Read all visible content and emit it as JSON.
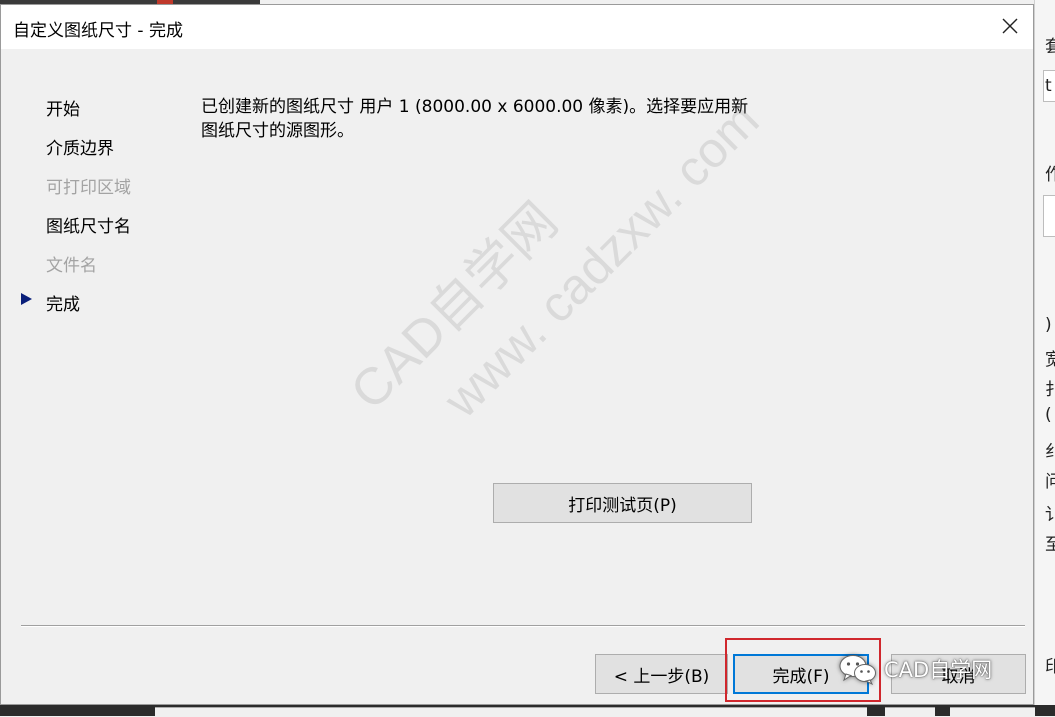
{
  "dialog": {
    "title": "自定义图纸尺寸 - 完成"
  },
  "steps": [
    {
      "label": "开始",
      "enabled": true
    },
    {
      "label": "介质边界",
      "enabled": true
    },
    {
      "label": "可打印区域",
      "enabled": false
    },
    {
      "label": "图纸尺寸名",
      "enabled": true
    },
    {
      "label": "文件名",
      "enabled": false
    },
    {
      "label": "完成",
      "enabled": true,
      "current": true
    }
  ],
  "content": {
    "line1": "已创建新的图纸尺寸 用户 1 (8000.00 x 6000.00 像素)。选择要应用新",
    "line2": "图纸尺寸的源图形。"
  },
  "buttons": {
    "print_test": "打印测试页(P)",
    "back": "< 上一步(B)",
    "finish": "完成(F)",
    "cancel": "取消"
  },
  "watermark": {
    "line1": "CAD自学网",
    "line2": "www. cadzxw. com"
  },
  "badge": {
    "text": "CAD自学网"
  },
  "background_fragments": [
    "套",
    "t",
    "作",
    ")",
    "宽",
    "扌",
    "(",
    "纟",
    "问",
    "讠",
    "至",
    "印"
  ]
}
